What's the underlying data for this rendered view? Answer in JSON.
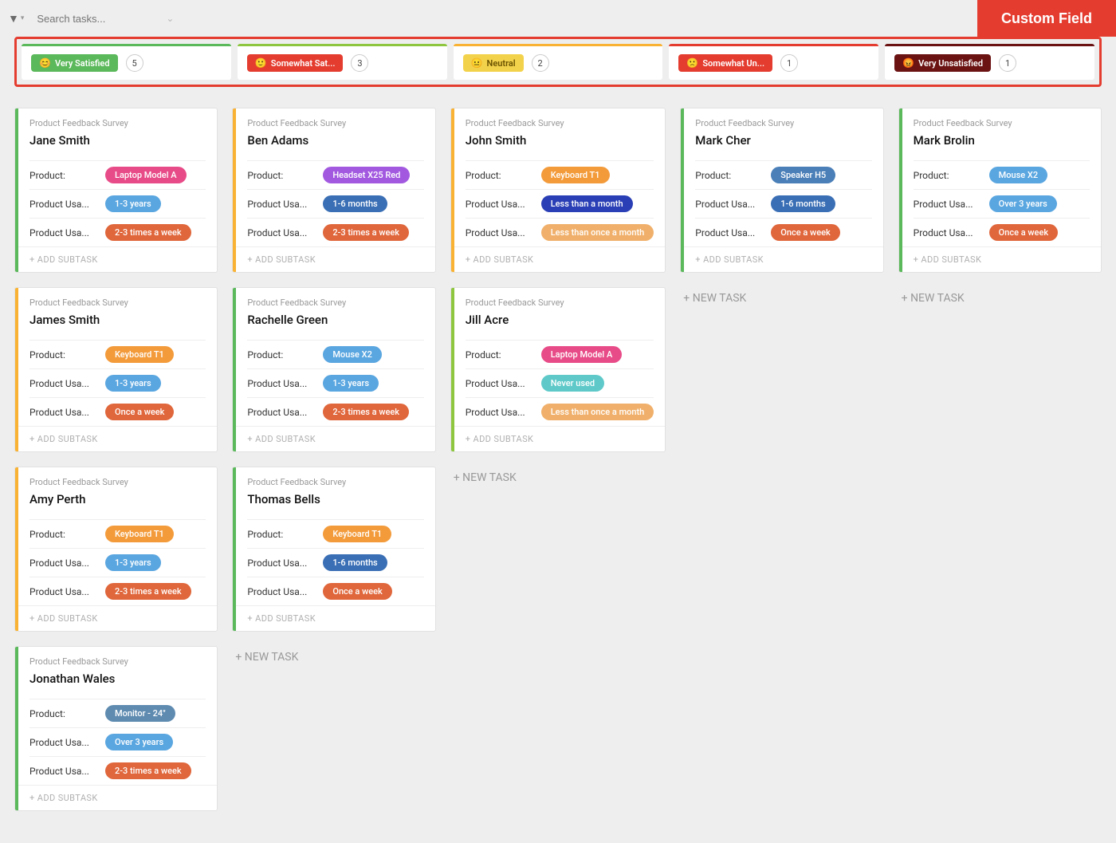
{
  "toolbar": {
    "search_placeholder": "Search tasks...",
    "custom_field_label": "Custom Field"
  },
  "labels": {
    "survey": "Product Feedback Survey",
    "product": "Product:",
    "usage_duration": "Product Usa...",
    "usage_freq": "Product Usa...",
    "add_subtask": "+ ADD SUBTASK",
    "new_task": "+ NEW TASK"
  },
  "columns": [
    {
      "name": "Very Satisfied",
      "emoji": "😊",
      "count": 5,
      "border": "bt-green",
      "pill_bg": "#5bb85b"
    },
    {
      "name": "Somewhat Sat...",
      "emoji": "🙂",
      "count": 3,
      "border": "bt-lime",
      "pill_bg": "#e43d30"
    },
    {
      "name": "Neutral",
      "emoji": "😐",
      "count": 2,
      "border": "bt-yellow",
      "pill_bg": "#f3d24b",
      "pill_text": "#6b5200"
    },
    {
      "name": "Somewhat Un...",
      "emoji": "🙁",
      "count": 1,
      "border": "bt-red",
      "pill_bg": "#e43d30"
    },
    {
      "name": "Very Unsatisfied",
      "emoji": "😡",
      "count": 1,
      "border": "bt-dark",
      "pill_bg": "#6b1313"
    }
  ],
  "pill_colors": {
    "laptop_a": {
      "bg": "#e84c88"
    },
    "headset": {
      "bg": "#a259e0"
    },
    "keyboard": {
      "bg": "#f39b3b"
    },
    "speaker": {
      "bg": "#4a7fb8"
    },
    "mouse": {
      "bg": "#5aa6e0"
    },
    "monitor": {
      "bg": "#5f8bb0"
    },
    "dur_1_3": {
      "bg": "#5aa6e0"
    },
    "dur_1_6m": {
      "bg": "#3a6fb5"
    },
    "dur_lt1m": {
      "bg": "#2a3fb5"
    },
    "dur_3y": {
      "bg": "#5aa6e0"
    },
    "dur_never": {
      "bg": "#5fc9c9"
    },
    "freq_23": {
      "bg": "#e0663b"
    },
    "freq_once": {
      "bg": "#e0663b"
    },
    "freq_lt1m": {
      "bg": "#f0b06b"
    }
  },
  "cards": {
    "col0": [
      {
        "stripe": "green",
        "title": "Jane Smith",
        "product": "Laptop Model A",
        "product_color": "laptop_a",
        "dur": "1-3 years",
        "dur_color": "dur_1_3",
        "freq": "2-3 times a week",
        "freq_color": "freq_23"
      },
      {
        "stripe": "yellow",
        "title": "James Smith",
        "product": "Keyboard T1",
        "product_color": "keyboard",
        "dur": "1-3 years",
        "dur_color": "dur_1_3",
        "freq": "Once a week",
        "freq_color": "freq_once"
      },
      {
        "stripe": "yellow",
        "title": "Amy Perth",
        "product": "Keyboard T1",
        "product_color": "keyboard",
        "dur": "1-3 years",
        "dur_color": "dur_1_3",
        "freq": "2-3 times a week",
        "freq_color": "freq_23"
      },
      {
        "stripe": "green",
        "title": "Jonathan Wales",
        "product": "Monitor - 24\"",
        "product_color": "monitor",
        "dur": "Over 3 years",
        "dur_color": "dur_3y",
        "freq": "2-3 times a week",
        "freq_color": "freq_23"
      }
    ],
    "col1": [
      {
        "stripe": "yellow",
        "title": "Ben Adams",
        "product": "Headset X25 Red",
        "product_color": "headset",
        "dur": "1-6 months",
        "dur_color": "dur_1_6m",
        "freq": "2-3 times a week",
        "freq_color": "freq_23"
      },
      {
        "stripe": "green",
        "title": "Rachelle Green",
        "product": "Mouse X2",
        "product_color": "mouse",
        "dur": "1-3 years",
        "dur_color": "dur_1_3",
        "freq": "2-3 times a week",
        "freq_color": "freq_23"
      },
      {
        "stripe": "green",
        "title": "Thomas Bells",
        "product": "Keyboard T1",
        "product_color": "keyboard",
        "dur": "1-6 months",
        "dur_color": "dur_1_6m",
        "freq": "Once a week",
        "freq_color": "freq_once"
      }
    ],
    "col2": [
      {
        "stripe": "yellow",
        "title": "John Smith",
        "product": "Keyboard T1",
        "product_color": "keyboard",
        "dur": "Less than a month",
        "dur_color": "dur_lt1m",
        "freq": "Less than once a month",
        "freq_color": "freq_lt1m"
      },
      {
        "stripe": "lime",
        "title": "Jill Acre",
        "product": "Laptop Model A",
        "product_color": "laptop_a",
        "dur": "Never used",
        "dur_color": "dur_never",
        "freq": "Less than once a month",
        "freq_color": "freq_lt1m"
      }
    ],
    "col3": [
      {
        "stripe": "green",
        "title": "Mark Cher",
        "product": "Speaker H5",
        "product_color": "speaker",
        "dur": "1-6 months",
        "dur_color": "dur_1_6m",
        "freq": "Once a week",
        "freq_color": "freq_once"
      }
    ],
    "col4": [
      {
        "stripe": "green",
        "title": "Mark Brolin",
        "product": "Mouse X2",
        "product_color": "mouse",
        "dur": "Over 3 years",
        "dur_color": "dur_3y",
        "freq": "Once a week",
        "freq_color": "freq_once"
      }
    ]
  }
}
